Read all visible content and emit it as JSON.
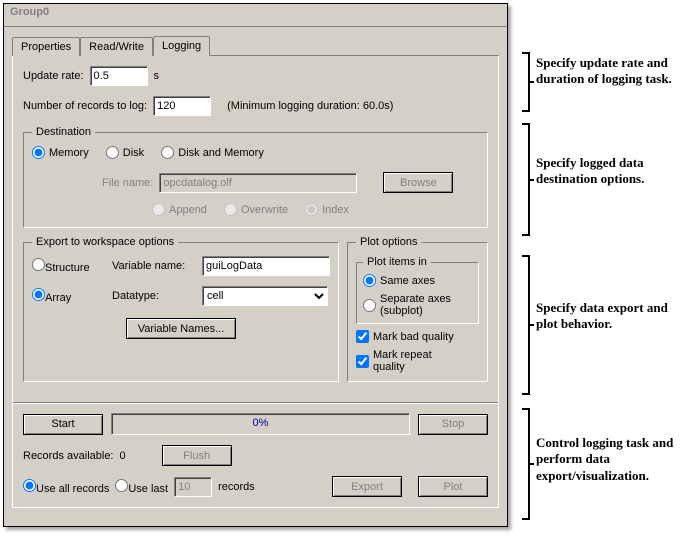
{
  "window": {
    "title": "Group0"
  },
  "tabs": {
    "properties": "Properties",
    "readwrite": "Read/Write",
    "logging": "Logging"
  },
  "update": {
    "label": "Update rate:",
    "value": "0.5",
    "unit": "s"
  },
  "records": {
    "label": "Number of records to log:",
    "value": "120",
    "hint": "(Minimum logging duration: 60.0s)"
  },
  "destination": {
    "legend": "Destination",
    "memory": "Memory",
    "disk": "Disk",
    "disk_and_memory": "Disk and Memory",
    "file_label": "File name:",
    "file_value": "opcdatalog.olf",
    "browse": "Browse",
    "append": "Append",
    "overwrite": "Overwrite",
    "index": "Index"
  },
  "export": {
    "legend": "Export to workspace options",
    "structure": "Structure",
    "array": "Array",
    "var_label": "Variable name:",
    "var_value": "guiLogData",
    "datatype_label": "Datatype:",
    "datatype_value": "cell",
    "var_names_btn": "Variable Names..."
  },
  "plot": {
    "legend": "Plot options",
    "items_legend": "Plot items in",
    "same_axes": "Same axes",
    "separate_axes": "Separate axes (subplot)",
    "mark_bad": "Mark bad quality",
    "mark_repeat": "Mark repeat quality"
  },
  "control": {
    "start": "Start",
    "stop": "Stop",
    "progress": "0%",
    "records_available_label": "Records available:",
    "records_available_value": "0",
    "flush": "Flush",
    "use_all": "Use all records",
    "use_last": "Use last",
    "use_last_value": "10",
    "records_suffix": "records",
    "export_btn": "Export",
    "plot_btn": "Plot"
  },
  "annotations": {
    "a1": "Specify update rate and duration of logging task.",
    "a2": "Specify logged data destination options.",
    "a3": "Specify data export and plot behavior.",
    "a4": "Control logging task and perform data export/visualization."
  }
}
